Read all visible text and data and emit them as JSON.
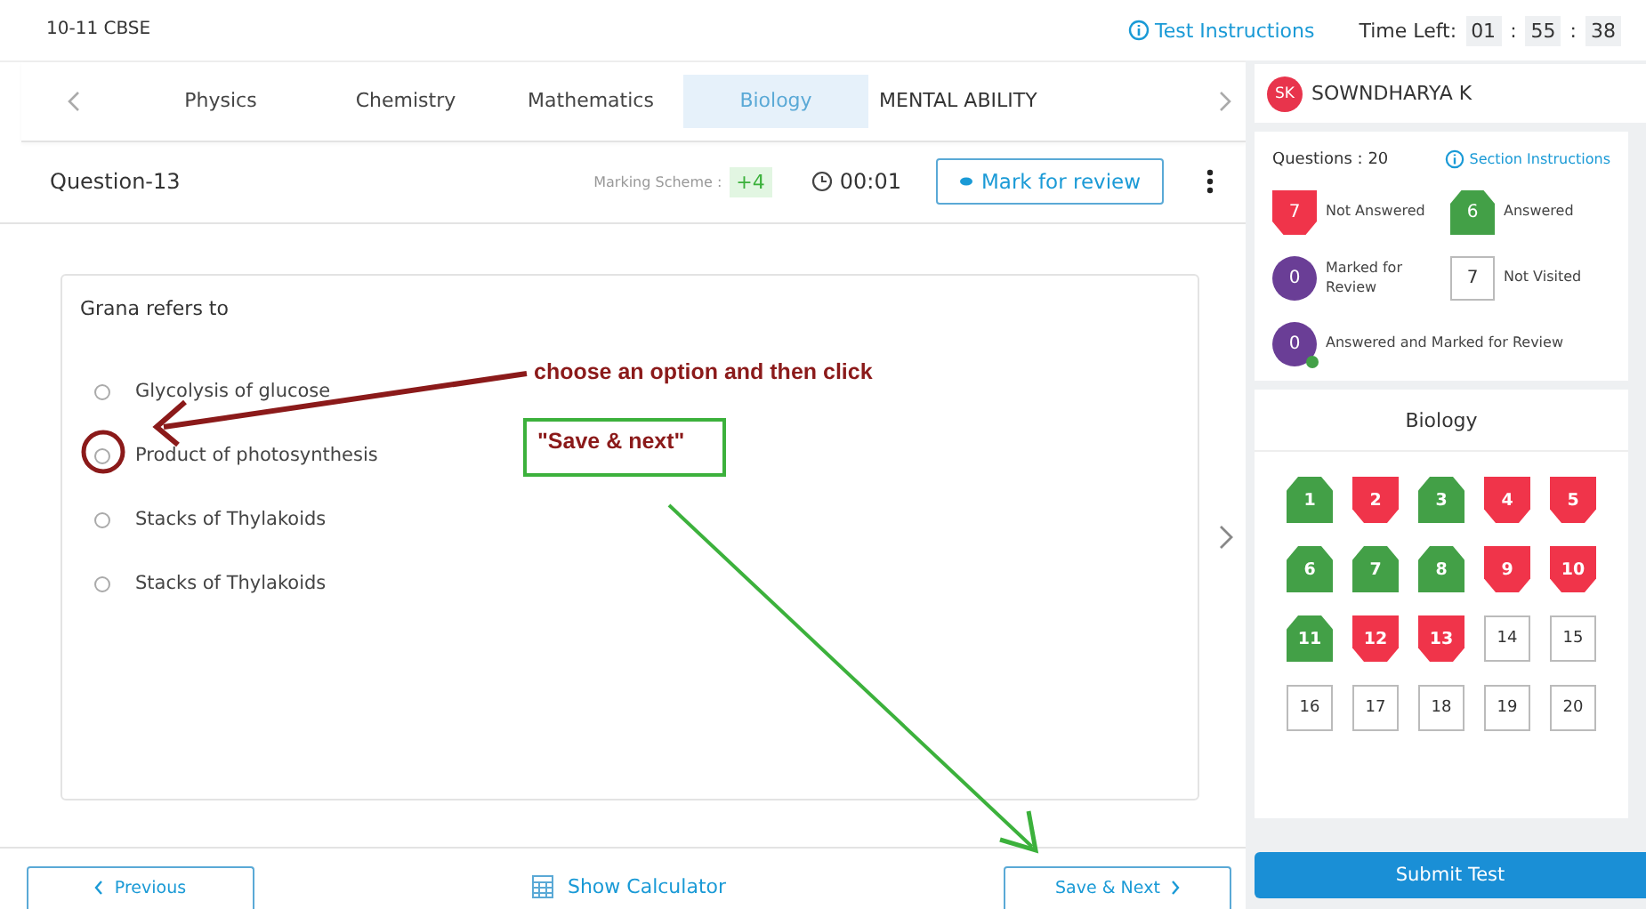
{
  "header": {
    "title": "10-11 CBSE",
    "instructions_link": "Test Instructions",
    "time_label": "Time Left:",
    "time_parts": [
      "01",
      "55",
      "38"
    ],
    "time_separators": [
      ":",
      ":"
    ]
  },
  "subject_tabs": [
    {
      "label": "Physics",
      "selected": false
    },
    {
      "label": "Chemistry",
      "selected": false
    },
    {
      "label": "Mathematics",
      "selected": false
    },
    {
      "label": "Biology",
      "selected": true
    },
    {
      "label": "MENTAL ABILITY",
      "selected": false
    }
  ],
  "question_bar": {
    "title": "Question-13",
    "marking_label": "Marking Scheme :",
    "marking_value": "+4",
    "timer": "00:01",
    "mark_button": "Mark for review"
  },
  "question": {
    "text": "Grana refers to",
    "options": [
      {
        "label": "Glycolysis of glucose",
        "selected": false
      },
      {
        "label": "Product of photosynthesis",
        "selected": false
      },
      {
        "label": "Stacks of Thylakoids",
        "selected": false
      },
      {
        "label": "Stacks of Thylakoids",
        "selected": false
      }
    ]
  },
  "annotations": {
    "instruction": "choose an option and then click",
    "highlight": "\"Save & next\""
  },
  "footer": {
    "previous": "Previous",
    "calculator": "Show Calculator",
    "save_next": "Save & Next"
  },
  "profile": {
    "initials": "SK",
    "name": "SOWNDHARYA K"
  },
  "summary": {
    "questions": "Questions : 20",
    "section_instructions": "Section Instructions",
    "legend": [
      {
        "kind": "not_answered",
        "count": "7",
        "label": "Not Answered"
      },
      {
        "kind": "answered",
        "count": "6",
        "label": "Answered"
      },
      {
        "kind": "marked",
        "count": "0",
        "label": "Marked for Review"
      },
      {
        "kind": "not_visited",
        "count": "7",
        "label": "Not Visited"
      },
      {
        "kind": "answered_marked",
        "count": "0",
        "label": "Answered and Marked for Review"
      }
    ]
  },
  "palette": {
    "title": "Biology",
    "questions": [
      {
        "number": "1",
        "kind": "answered"
      },
      {
        "number": "2",
        "kind": "not_answered"
      },
      {
        "number": "3",
        "kind": "answered"
      },
      {
        "number": "4",
        "kind": "not_answered"
      },
      {
        "number": "5",
        "kind": "not_answered"
      },
      {
        "number": "6",
        "kind": "answered"
      },
      {
        "number": "7",
        "kind": "answered"
      },
      {
        "number": "8",
        "kind": "answered"
      },
      {
        "number": "9",
        "kind": "not_answered"
      },
      {
        "number": "10",
        "kind": "not_answered"
      },
      {
        "number": "11",
        "kind": "answered"
      },
      {
        "number": "12",
        "kind": "not_answered"
      },
      {
        "number": "13",
        "kind": "not_answered"
      },
      {
        "number": "14",
        "kind": "not_visited"
      },
      {
        "number": "15",
        "kind": "not_visited"
      },
      {
        "number": "16",
        "kind": "not_visited"
      },
      {
        "number": "17",
        "kind": "not_visited"
      },
      {
        "number": "18",
        "kind": "not_visited"
      },
      {
        "number": "19",
        "kind": "not_visited"
      },
      {
        "number": "20",
        "kind": "not_visited"
      }
    ]
  },
  "submit": "Submit Test"
}
